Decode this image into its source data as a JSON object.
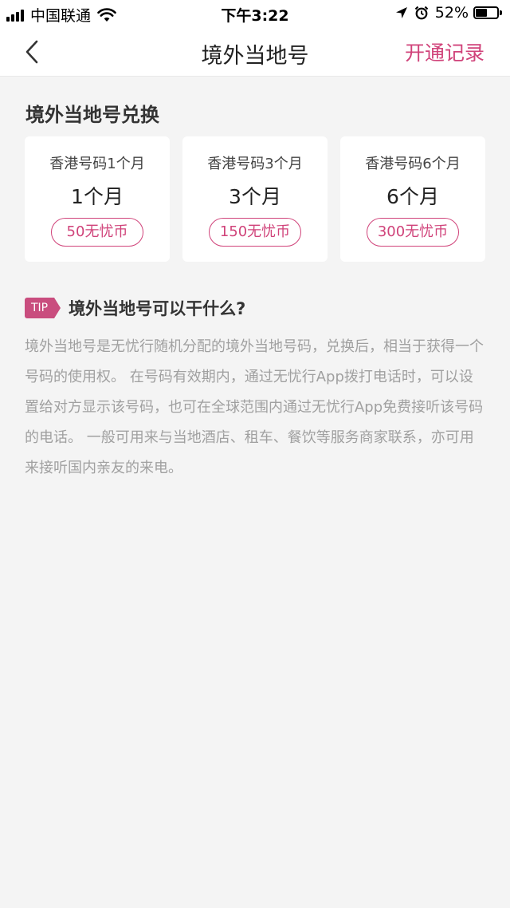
{
  "status_bar": {
    "carrier": "中国联通",
    "time": "下午3:22",
    "battery_percent": "52%",
    "battery_level": 0.52
  },
  "nav": {
    "title": "境外当地号",
    "action": "开通记录",
    "back_icon": "chevron-left-icon"
  },
  "section_title": "境外当地号兑换",
  "cards": [
    {
      "name": "香港号码1个月",
      "duration": "1个月",
      "price": "50无忧币"
    },
    {
      "name": "香港号码3个月",
      "duration": "3个月",
      "price": "150无忧币"
    },
    {
      "name": "香港号码6个月",
      "duration": "6个月",
      "price": "300无忧币"
    }
  ],
  "tip": {
    "badge": "TIP",
    "title": "境外当地号可以干什么?",
    "description": "境外当地号是无忧行随机分配的境外当地号码，兑换后，相当于获得一个号码的使用权。 在号码有效期内，通过无忧行App拨打电话时，可以设置给对方显示该号码，也可在全球范围内通过无忧行App免费接听该号码的电话。 一般可用来与当地酒店、租车、餐饮等服务商家联系，亦可用来接听国内亲友的来电。"
  },
  "colors": {
    "accent": "#d0437a",
    "tip_badge": "#c94d7e",
    "background": "#f4f4f4"
  }
}
